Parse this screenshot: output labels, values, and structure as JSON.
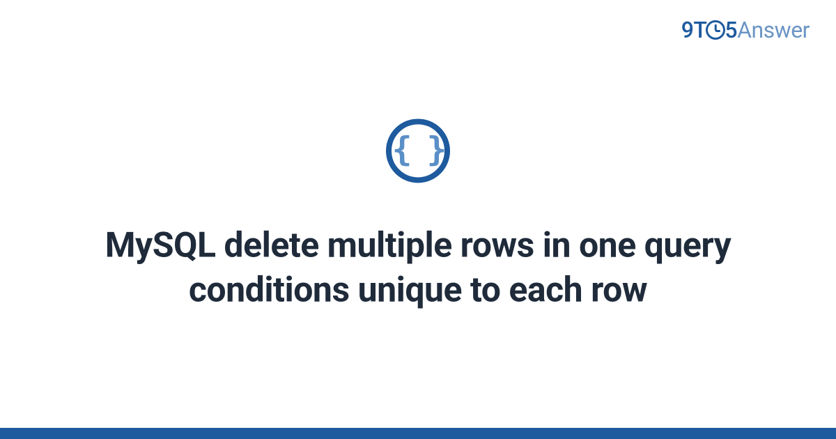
{
  "logo": {
    "prefix": "9T",
    "suffix": "5",
    "word": "Answer"
  },
  "icon": {
    "glyph": "{ }",
    "name": "code-braces-icon"
  },
  "title": "MySQL delete multiple rows in one query conditions unique to each row"
}
